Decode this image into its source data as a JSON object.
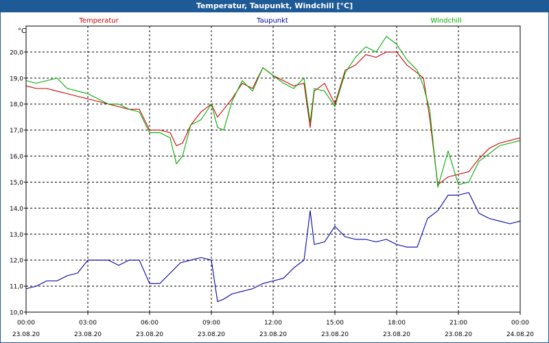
{
  "window": {
    "title": "Temperatur, Taupunkt, Windchill [°C]"
  },
  "chart_data": {
    "type": "line",
    "title": "Temperatur, Taupunkt, Windchill [°C]",
    "ylabel": "°C",
    "ylim": [
      10.0,
      21.0
    ],
    "xlim": [
      0,
      24
    ],
    "grid": true,
    "legend_placement": "top",
    "y_ticks": [
      "10,0",
      "11,0",
      "12,0",
      "13,0",
      "14,0",
      "15,0",
      "16,0",
      "17,0",
      "18,0",
      "19,0",
      "20,0"
    ],
    "x_ticks": [
      {
        "time": "00:00",
        "date": "23.08.20"
      },
      {
        "time": "03:00",
        "date": "23.08.20"
      },
      {
        "time": "06:00",
        "date": "23.08.20"
      },
      {
        "time": "09:00",
        "date": "23.08.20"
      },
      {
        "time": "12:00",
        "date": "23.08.20"
      },
      {
        "time": "15:00",
        "date": "23.08.20"
      },
      {
        "time": "18:00",
        "date": "23.08.20"
      },
      {
        "time": "21:00",
        "date": "23.08.20"
      },
      {
        "time": "00:00",
        "date": "24.08.20"
      }
    ],
    "series": [
      {
        "name": "Temperatur",
        "color": "#cc0000",
        "x": [
          0,
          0.5,
          1,
          1.5,
          2,
          2.5,
          3,
          3.5,
          4,
          4.5,
          5,
          5.5,
          6,
          6.5,
          7,
          7.3,
          7.6,
          8,
          8.5,
          9,
          9.3,
          9.6,
          10,
          10.5,
          11,
          11.5,
          12,
          12.5,
          13,
          13.5,
          13.8,
          14,
          14.5,
          15,
          15.5,
          16,
          16.5,
          17,
          17.5,
          18,
          18.5,
          19,
          19.3,
          19.6,
          20,
          20.5,
          21,
          21.5,
          22,
          22.5,
          23,
          23.5,
          24
        ],
        "y": [
          18.7,
          18.6,
          18.6,
          18.5,
          18.4,
          18.3,
          18.2,
          18.1,
          18.0,
          17.9,
          17.8,
          17.8,
          17.0,
          17.0,
          16.9,
          16.4,
          16.5,
          17.2,
          17.7,
          18.0,
          17.5,
          17.8,
          18.2,
          18.8,
          18.6,
          19.4,
          19.1,
          18.9,
          18.7,
          18.8,
          17.1,
          18.5,
          18.8,
          18.0,
          19.3,
          19.5,
          19.9,
          19.8,
          20.0,
          20.0,
          19.5,
          19.2,
          19.0,
          17.5,
          14.9,
          15.2,
          15.3,
          15.4,
          15.9,
          16.3,
          16.5,
          16.6,
          16.7
        ]
      },
      {
        "name": "Taupunkt",
        "color": "#0000aa",
        "x": [
          0,
          0.5,
          1,
          1.5,
          2,
          2.5,
          3,
          3.5,
          4,
          4.5,
          5,
          5.5,
          6,
          6.5,
          7,
          7.5,
          8,
          8.5,
          9,
          9.3,
          9.6,
          10,
          10.5,
          11,
          11.5,
          12,
          12.5,
          13,
          13.5,
          13.8,
          14,
          14.5,
          15,
          15.5,
          16,
          16.5,
          17,
          17.5,
          18,
          18.5,
          19,
          19.5,
          20,
          20.5,
          21,
          21.5,
          22,
          22.5,
          23,
          23.5,
          24
        ],
        "y": [
          10.9,
          11.0,
          11.2,
          11.2,
          11.4,
          11.5,
          12.0,
          12.0,
          12.0,
          11.8,
          12.0,
          12.0,
          11.1,
          11.1,
          11.5,
          11.9,
          12.0,
          12.1,
          12.0,
          10.4,
          10.5,
          10.7,
          10.8,
          10.9,
          11.1,
          11.2,
          11.3,
          11.7,
          12.0,
          13.9,
          12.6,
          12.7,
          13.3,
          12.9,
          12.8,
          12.8,
          12.7,
          12.8,
          12.6,
          12.5,
          12.5,
          13.6,
          13.9,
          14.5,
          14.5,
          14.6,
          13.8,
          13.6,
          13.5,
          13.4,
          13.5
        ]
      },
      {
        "name": "Windchill",
        "color": "#00aa00",
        "x": [
          0,
          0.5,
          1,
          1.5,
          2,
          2.5,
          3,
          3.5,
          4,
          4.5,
          5,
          5.5,
          6,
          6.5,
          7,
          7.3,
          7.6,
          8,
          8.5,
          9,
          9.3,
          9.6,
          10,
          10.5,
          11,
          11.5,
          12,
          12.5,
          13,
          13.5,
          13.8,
          14,
          14.5,
          15,
          15.5,
          16,
          16.5,
          17,
          17.5,
          18,
          18.5,
          19,
          19.3,
          19.6,
          20,
          20.5,
          21,
          21.5,
          22,
          22.5,
          23,
          23.5,
          24
        ],
        "y": [
          18.9,
          18.8,
          18.9,
          19.0,
          18.6,
          18.5,
          18.4,
          18.2,
          18.0,
          18.0,
          17.8,
          17.7,
          16.9,
          16.9,
          16.7,
          15.7,
          16.0,
          17.2,
          17.4,
          18.0,
          17.1,
          17.0,
          18.1,
          18.9,
          18.5,
          19.4,
          19.1,
          18.8,
          18.6,
          19.0,
          17.3,
          18.6,
          18.5,
          17.9,
          19.2,
          19.8,
          20.2,
          20.0,
          20.6,
          20.3,
          19.7,
          19.3,
          18.7,
          17.8,
          14.8,
          16.2,
          14.9,
          15.0,
          15.8,
          16.1,
          16.4,
          16.5,
          16.6
        ]
      }
    ]
  }
}
